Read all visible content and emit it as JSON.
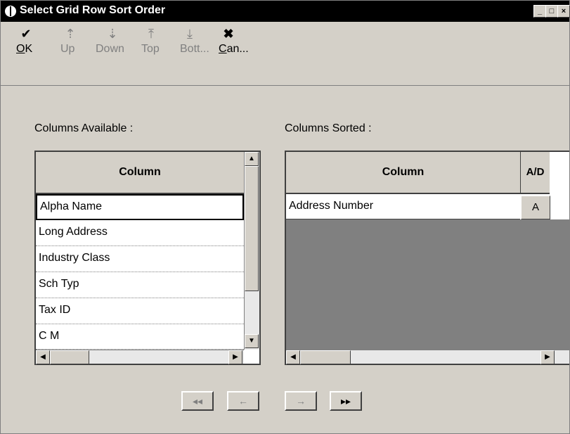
{
  "window": {
    "title": "Select Grid Row Sort Order",
    "controls": [
      "minimize-icon",
      "maximize-icon",
      "close-icon"
    ]
  },
  "toolbar": {
    "items": [
      {
        "label_u": "O",
        "label_rest": "K",
        "icon": "checkmark-icon",
        "enabled": true
      },
      {
        "label_u": "",
        "label_rest": "Up",
        "icon": "arrow-up-icon",
        "enabled": false
      },
      {
        "label_u": "",
        "label_rest": "Down",
        "icon": "arrow-down-icon",
        "enabled": false
      },
      {
        "label_u": "",
        "label_rest": "Top",
        "icon": "arrow-top-icon",
        "enabled": false
      },
      {
        "label_u": "",
        "label_rest": "Bott...",
        "icon": "arrow-bottom-icon",
        "enabled": false
      },
      {
        "label_u": "C",
        "label_rest": "an...",
        "icon": "cancel-x-icon",
        "enabled": true
      }
    ]
  },
  "available": {
    "label": "Columns Available :",
    "header": "Column",
    "rows": [
      "Alpha Name",
      "Long Address",
      "Industry Class",
      "Sch Typ",
      "Tax ID",
      "C M"
    ],
    "selected_index": 0
  },
  "sorted": {
    "label": "Columns Sorted :",
    "header": "Column",
    "ad_header": "A/D",
    "rows": [
      {
        "column": "Address Number",
        "ad": "A"
      }
    ]
  },
  "move_buttons": [
    {
      "glyph": "◂◂",
      "icon": "remove-all-icon",
      "enabled": false
    },
    {
      "glyph": "←",
      "icon": "remove-icon",
      "enabled": false
    },
    {
      "glyph": "→",
      "icon": "add-icon",
      "enabled": false
    },
    {
      "glyph": "▸▸",
      "icon": "add-all-icon",
      "enabled": true
    }
  ]
}
